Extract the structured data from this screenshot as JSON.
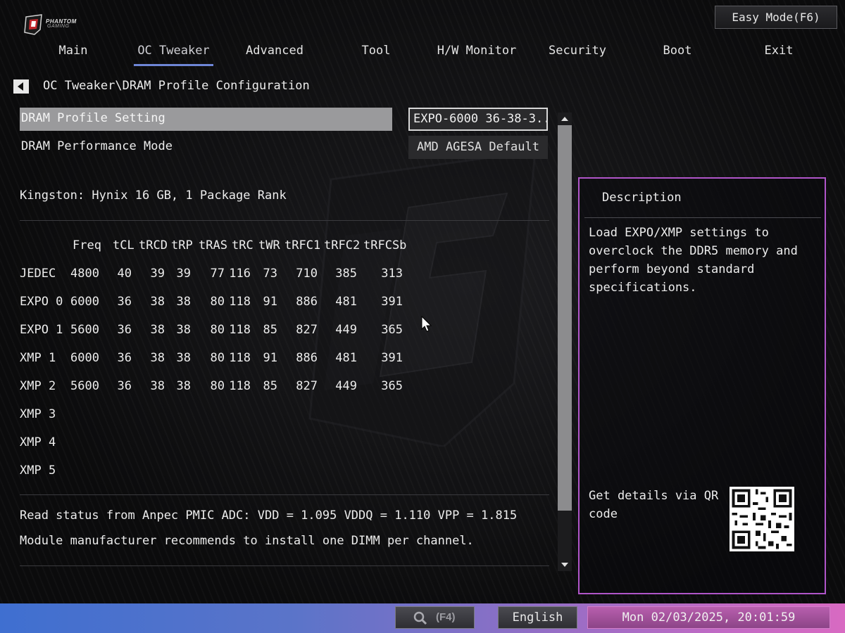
{
  "header": {
    "logo_text": [
      "PHANTOM",
      "GAMING"
    ],
    "easy_mode_label": "Easy Mode(F6)"
  },
  "nav": {
    "tabs": [
      {
        "label": "Main"
      },
      {
        "label": "OC Tweaker",
        "active": true
      },
      {
        "label": "Advanced"
      },
      {
        "label": "Tool"
      },
      {
        "label": "H/W Monitor"
      },
      {
        "label": "Security"
      },
      {
        "label": "Boot"
      },
      {
        "label": "Exit"
      }
    ]
  },
  "breadcrumb": "OC Tweaker\\DRAM Profile Configuration",
  "settings": [
    {
      "label": "DRAM Profile Setting",
      "value": "EXPO-6000 36-38-3...",
      "selected": true
    },
    {
      "label": "DRAM Performance Mode",
      "value": "AMD AGESA Default"
    }
  ],
  "module_info": "Kingston: Hynix 16 GB, 1 Package Rank",
  "timings_table": {
    "headers": [
      "Freq",
      "tCL",
      "tRCD",
      "tRP",
      "tRAS",
      "tRC",
      "tWR",
      "tRFC1",
      "tRFC2",
      "tRFCSb"
    ],
    "rows": [
      {
        "label": "JEDEC",
        "values": [
          "4800",
          "40",
          "39",
          "39",
          "77",
          "116",
          "73",
          "710",
          "385",
          "313"
        ]
      },
      {
        "label": "EXPO 0",
        "values": [
          "6000",
          "36",
          "38",
          "38",
          "80",
          "118",
          "91",
          "886",
          "481",
          "391"
        ]
      },
      {
        "label": "EXPO 1",
        "values": [
          "5600",
          "36",
          "38",
          "38",
          "80",
          "118",
          "85",
          "827",
          "449",
          "365"
        ]
      },
      {
        "label": "XMP 1",
        "values": [
          "6000",
          "36",
          "38",
          "38",
          "80",
          "118",
          "91",
          "886",
          "481",
          "391"
        ]
      },
      {
        "label": "XMP 2",
        "values": [
          "5600",
          "36",
          "38",
          "38",
          "80",
          "118",
          "85",
          "827",
          "449",
          "365"
        ]
      },
      {
        "label": "XMP 3",
        "values": []
      },
      {
        "label": "XMP 4",
        "values": []
      },
      {
        "label": "XMP 5",
        "values": []
      }
    ]
  },
  "status_lines": [
    "Read status from Anpec PMIC ADC: VDD = 1.095 VDDQ = 1.110 VPP = 1.815",
    "Module manufacturer recommends to install one DIMM per channel."
  ],
  "description": {
    "title": "Description",
    "text": "Load EXPO/XMP settings to overclock the DDR5 memory and perform beyond standard specifications.",
    "qr_label": "Get details via QR code"
  },
  "footer": {
    "search_shortcut": "(F4)",
    "language": "English",
    "datetime": "Mon 02/03/2025, 20:01:59"
  },
  "colors": {
    "accent_underline": "#6e86d6",
    "description_border": "#b055c9",
    "selected_row": "#9a9a9c"
  }
}
